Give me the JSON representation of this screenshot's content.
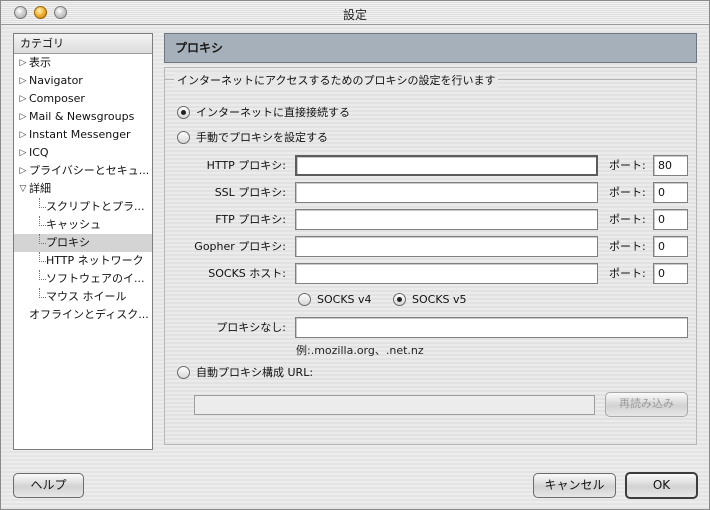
{
  "window": {
    "title": "設定"
  },
  "sidebar": {
    "header": "カテゴリ",
    "items": [
      {
        "label": "表示",
        "tri": "▷"
      },
      {
        "label": "Navigator",
        "tri": "▷"
      },
      {
        "label": "Composer",
        "tri": "▷"
      },
      {
        "label": "Mail & Newsgroups",
        "tri": "▷"
      },
      {
        "label": "Instant Messenger",
        "tri": "▷"
      },
      {
        "label": "ICQ",
        "tri": "▷"
      },
      {
        "label": "プライバシーとセキュ...",
        "tri": "▷"
      },
      {
        "label": "詳細",
        "tri": "▽"
      },
      {
        "label": "スクリプトとプラ..."
      },
      {
        "label": "キャッシュ"
      },
      {
        "label": "プロキシ"
      },
      {
        "label": "HTTP ネットワーク"
      },
      {
        "label": "ソフトウェアのイ..."
      },
      {
        "label": "マウス ホイール"
      },
      {
        "label": "オフラインとディスク..."
      }
    ]
  },
  "panel": {
    "title": "プロキシ",
    "group_title": "インターネットにアクセスするためのプロキシの設定を行います",
    "direct_label": "インターネットに直接接続する",
    "manual_label": "手動でプロキシを設定する",
    "port_label": "ポート:",
    "proxies": [
      {
        "label": "HTTP プロキシ:",
        "value": "",
        "port": "80"
      },
      {
        "label": "SSL プロキシ:",
        "value": "",
        "port": "0"
      },
      {
        "label": "FTP プロキシ:",
        "value": "",
        "port": "0"
      },
      {
        "label": "Gopher プロキシ:",
        "value": "",
        "port": "0"
      },
      {
        "label": "SOCKS ホスト:",
        "value": "",
        "port": "0"
      }
    ],
    "socks_v4": "SOCKS v4",
    "socks_v5": "SOCKS v5",
    "no_proxy_label": "プロキシなし:",
    "no_proxy_value": "",
    "no_proxy_hint": "例:.mozilla.org、.net.nz",
    "auto_label": "自動プロキシ構成 URL:",
    "auto_url_value": "",
    "reload_button": "再読み込み"
  },
  "footer": {
    "help_button": "ヘルプ",
    "cancel_button": "キャンセル",
    "ok_button": "OK"
  },
  "state": {
    "connection_mode": "direct",
    "socks_version": "v5",
    "selected_category": "プロキシ"
  }
}
